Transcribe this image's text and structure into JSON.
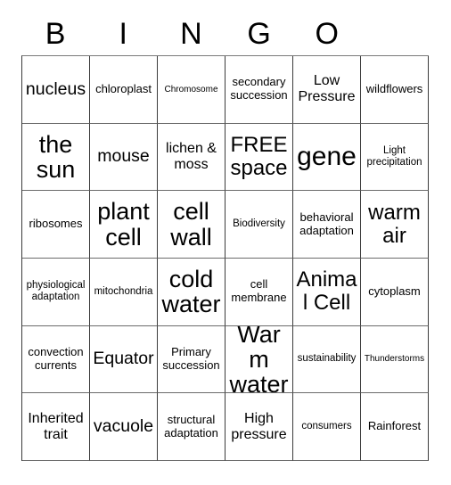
{
  "card": {
    "title": "BINGO",
    "header_letters": [
      "B",
      "I",
      "N",
      "G",
      "O",
      ""
    ],
    "columns": 6,
    "rows": 6,
    "free_space_label": "FREE space",
    "border_color": "#3b3b3b",
    "background_color": "#ffffff",
    "text_color": "#000000"
  },
  "grid": [
    [
      {
        "text": "nucleus",
        "size": "sz-xl"
      },
      {
        "text": "chloroplast",
        "size": "sz-m"
      },
      {
        "text": "Chromosome",
        "size": "sz-xs"
      },
      {
        "text": "secondary succession",
        "size": "sz-m"
      },
      {
        "text": "Low Pressure",
        "size": "sz-l"
      },
      {
        "text": "wildflowers",
        "size": "sz-m"
      }
    ],
    [
      {
        "text": "the sun",
        "size": "sz-3xl"
      },
      {
        "text": "mouse",
        "size": "sz-xl"
      },
      {
        "text": "lichen & moss",
        "size": "sz-l"
      },
      {
        "text": "FREE space",
        "size": "sz-xxl"
      },
      {
        "text": "gene",
        "size": "sz-4xl"
      },
      {
        "text": "Light precipitation",
        "size": "sz-s"
      }
    ],
    [
      {
        "text": "ribosomes",
        "size": "sz-m"
      },
      {
        "text": "plant cell",
        "size": "sz-3xl"
      },
      {
        "text": "cell wall",
        "size": "sz-3xl"
      },
      {
        "text": "Biodiversity",
        "size": "sz-s"
      },
      {
        "text": "behavioral adaptation",
        "size": "sz-m"
      },
      {
        "text": "warm air",
        "size": "sz-xxl"
      }
    ],
    [
      {
        "text": "physiological adaptation",
        "size": "sz-s"
      },
      {
        "text": "mitochondria",
        "size": "sz-s"
      },
      {
        "text": "cold water",
        "size": "sz-3xl"
      },
      {
        "text": "cell membrane",
        "size": "sz-m"
      },
      {
        "text": "Animal Cell",
        "size": "sz-xxl"
      },
      {
        "text": "cytoplasm",
        "size": "sz-m"
      }
    ],
    [
      {
        "text": "convection currents",
        "size": "sz-m"
      },
      {
        "text": "Equator",
        "size": "sz-xl"
      },
      {
        "text": "Primary succession",
        "size": "sz-m"
      },
      {
        "text": "Warm water",
        "size": "sz-3xl"
      },
      {
        "text": "sustainability",
        "size": "sz-s"
      },
      {
        "text": "Thunderstorms",
        "size": "sz-xs"
      }
    ],
    [
      {
        "text": "Inherited trait",
        "size": "sz-l"
      },
      {
        "text": "vacuole",
        "size": "sz-xl"
      },
      {
        "text": "structural adaptation",
        "size": "sz-m"
      },
      {
        "text": "High pressure",
        "size": "sz-l"
      },
      {
        "text": "consumers",
        "size": "sz-s"
      },
      {
        "text": "Rainforest",
        "size": "sz-m"
      }
    ]
  ]
}
